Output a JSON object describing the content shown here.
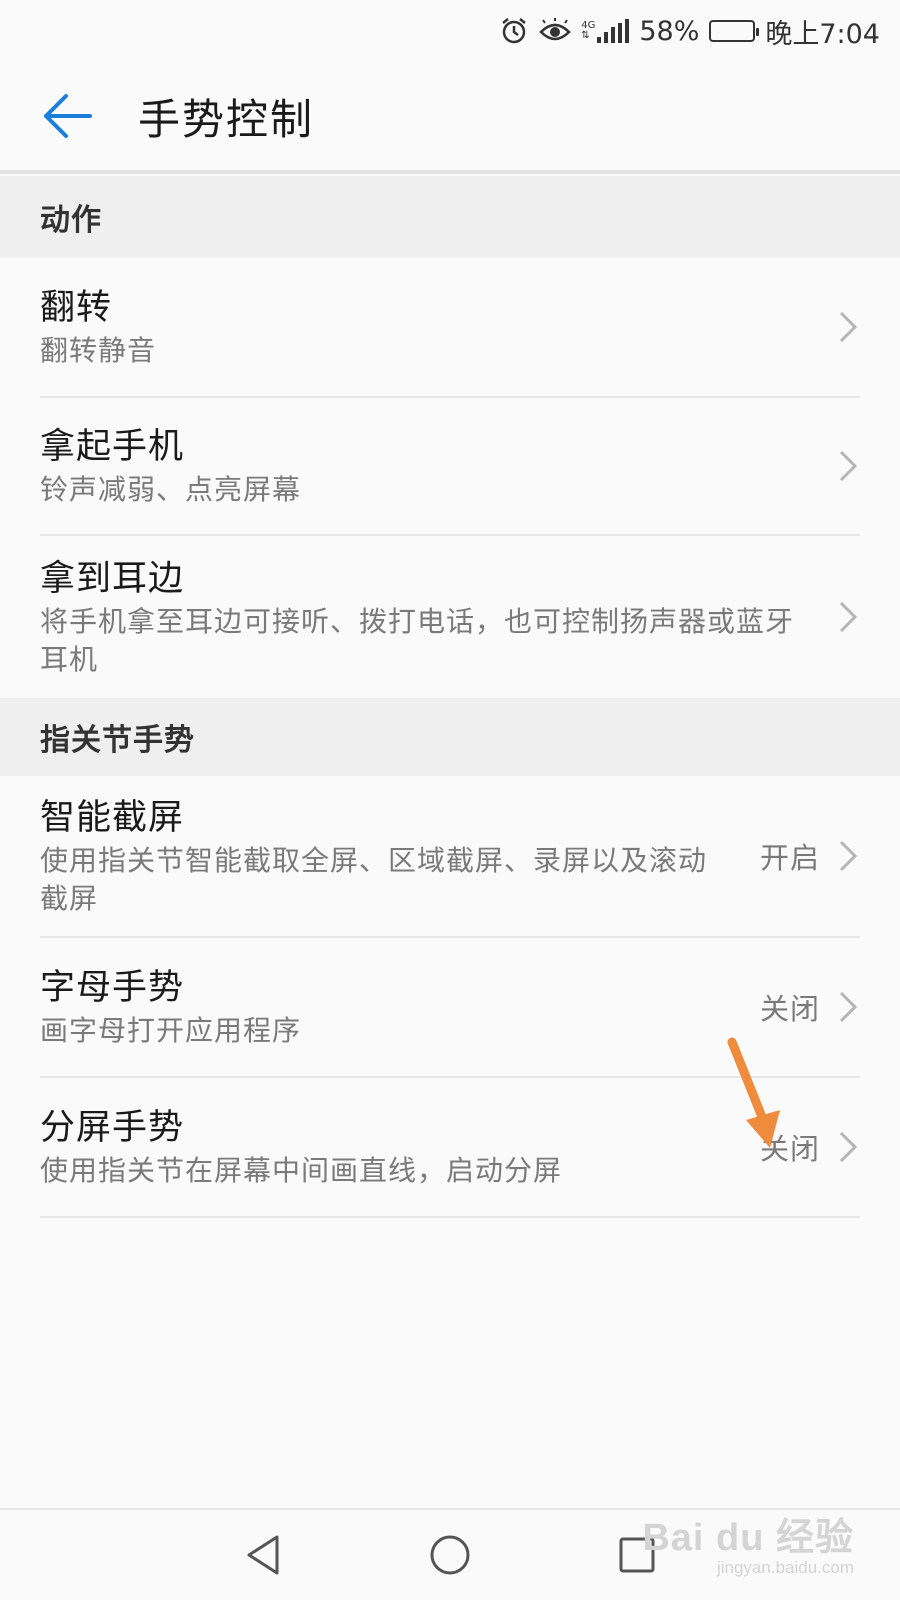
{
  "status_bar": {
    "network": "4G",
    "battery_percent": "58%",
    "battery_level": 0.58,
    "time": "晚上7:04",
    "icons": [
      "alarm-icon",
      "eye-comfort-icon",
      "signal-icon",
      "battery-icon"
    ]
  },
  "header": {
    "title": "手势控制",
    "back_icon": "arrow-left-icon",
    "accent_color": "#1a7fd8"
  },
  "sections": [
    {
      "header": "动作",
      "items": [
        {
          "title": "翻转",
          "subtitle": "翻转静音",
          "value": ""
        },
        {
          "title": "拿起手机",
          "subtitle": "铃声减弱、点亮屏幕",
          "value": ""
        },
        {
          "title": "拿到耳边",
          "subtitle": "将手机拿至耳边可接听、拨打电话，也可控制扬声器或蓝牙耳机",
          "value": ""
        }
      ]
    },
    {
      "header": "指关节手势",
      "items": [
        {
          "title": "智能截屏",
          "subtitle": "使用指关节智能截取全屏、区域截屏、录屏以及滚动截屏",
          "value": "开启"
        },
        {
          "title": "字母手势",
          "subtitle": "画字母打开应用程序",
          "value": "关闭"
        },
        {
          "title": "分屏手势",
          "subtitle": "使用指关节在屏幕中间画直线，启动分屏",
          "value": "关闭"
        }
      ]
    }
  ],
  "annotation": {
    "color": "#ef8b3c",
    "icon": "orange-arrow-icon"
  },
  "nav_bar": {
    "icons": [
      "back-triangle-icon",
      "home-circle-icon",
      "recents-square-icon"
    ]
  },
  "watermark": {
    "main": "Bai du 经验",
    "sub": "jingyan.baidu.com"
  }
}
